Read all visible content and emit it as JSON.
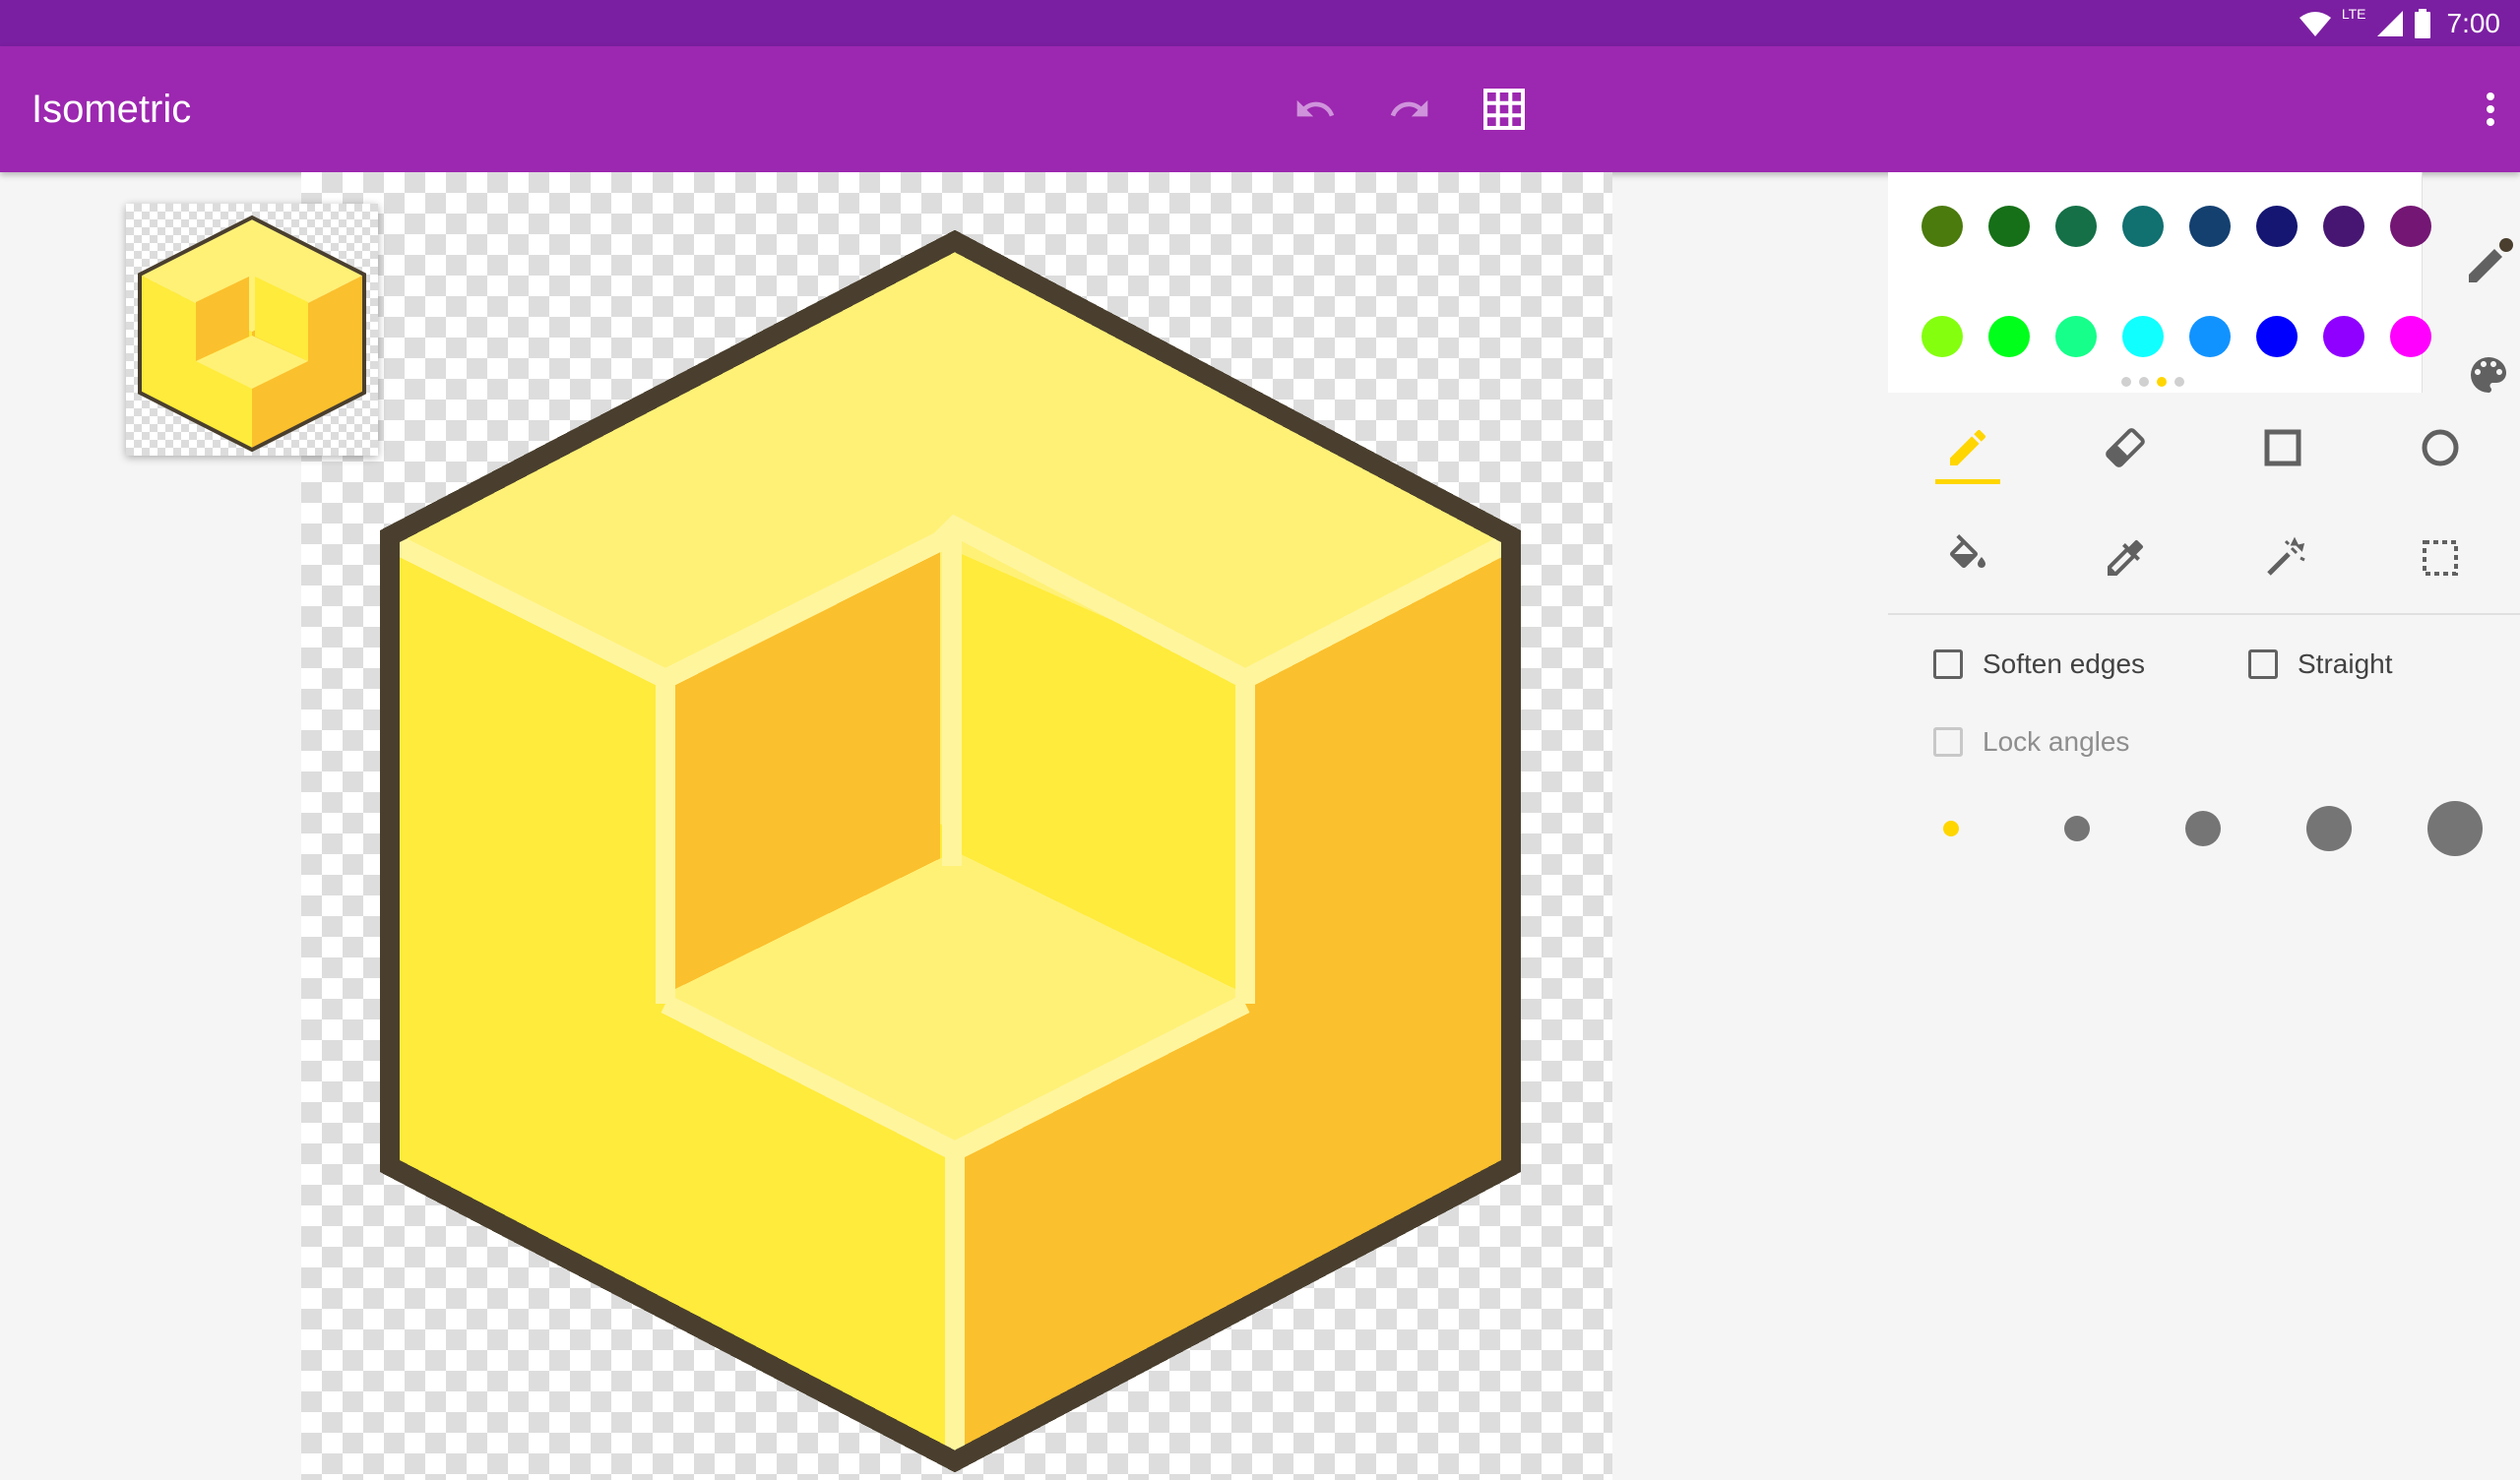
{
  "status_bar": {
    "time": "7:00",
    "network_label": "LTE",
    "icons": [
      "wifi-icon",
      "signal-icon",
      "battery-icon"
    ]
  },
  "app_bar": {
    "title": "Isometric",
    "actions": [
      "undo-icon",
      "redo-icon",
      "grid-icon",
      "more-vert-icon"
    ]
  },
  "colors": {
    "status_bar": "#7b1fa2",
    "app_bar": "#9c27b0",
    "accent": "#ffd600",
    "cube_outline": "#4a3f2e",
    "cube_top": "#fff176",
    "cube_left": "#ffeb3b",
    "cube_right": "#fbc02d",
    "cube_highlight": "#fff59d"
  },
  "palette": {
    "row1": [
      "#4b7a0d",
      "#167018",
      "#157047",
      "#117070",
      "#144070",
      "#141672",
      "#471672",
      "#741674"
    ],
    "row2": [
      "#84ff0e",
      "#00ff1a",
      "#16ff8a",
      "#10ffff",
      "#1193ff",
      "#0000ff",
      "#8f00ff",
      "#ff00ff"
    ],
    "page_dots": 4,
    "active_page": 2,
    "side_tools": [
      "color-picker-pen-icon",
      "palette-icon"
    ]
  },
  "tools": {
    "row1": [
      "pencil-icon",
      "eraser-icon",
      "rectangle-icon",
      "circle-icon"
    ],
    "row2": [
      "fill-bucket-icon",
      "eyedropper-icon",
      "magic-wand-icon",
      "selection-icon"
    ],
    "selected": "pencil-icon"
  },
  "options": {
    "soften_edges": {
      "label": "Soften edges",
      "checked": false,
      "enabled": true
    },
    "straight": {
      "label": "Straight",
      "checked": false,
      "enabled": true
    },
    "lock_angles": {
      "label": "Lock angles",
      "checked": false,
      "enabled": false
    }
  },
  "brush_sizes": {
    "count": 5,
    "selected_index": 0
  }
}
